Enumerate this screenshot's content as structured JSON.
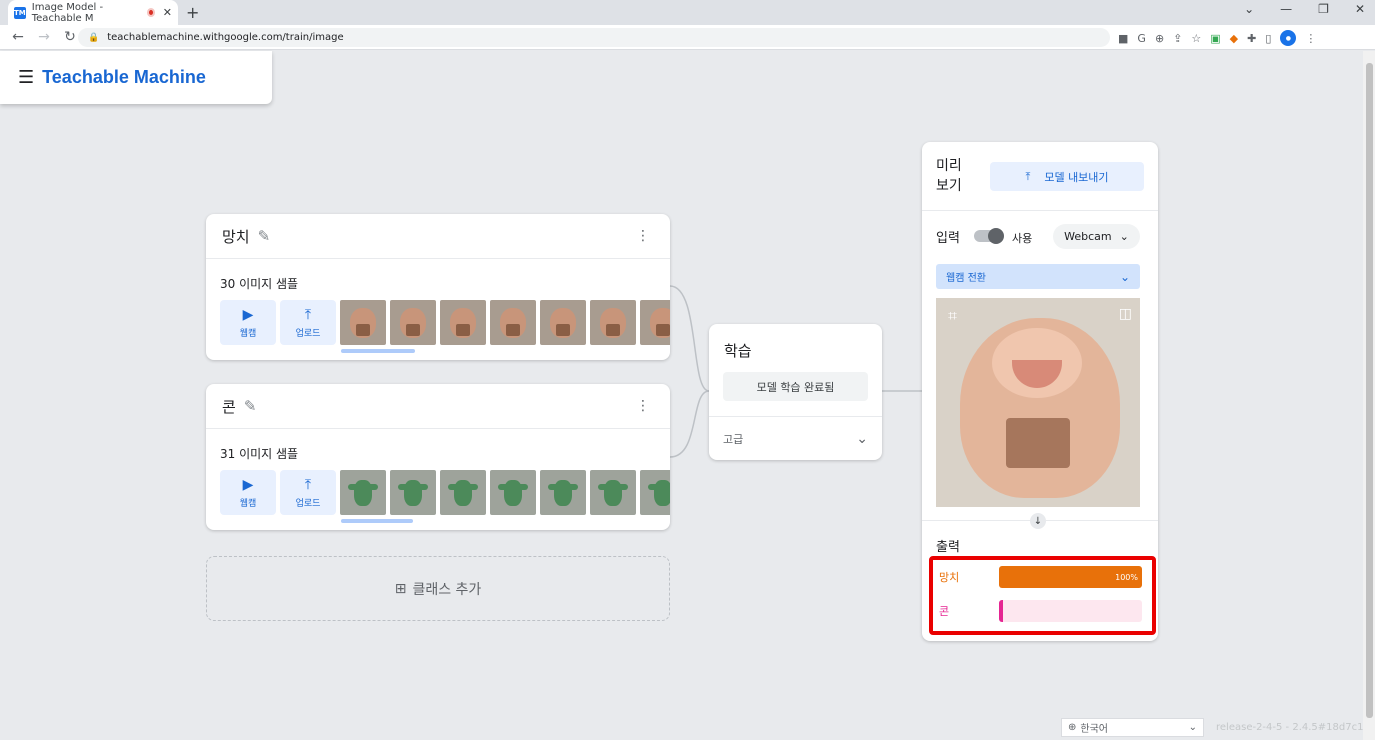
{
  "browser": {
    "tab_title": "Image Model - Teachable M",
    "favicon_text": "TM",
    "url": "teachablemachine.withgoogle.com/train/image"
  },
  "app": {
    "title": "Teachable Machine"
  },
  "classes": [
    {
      "name": "망치",
      "sample_count_label": "30 이미지 샘플",
      "webcam_label": "웹캠",
      "upload_label": "업로드",
      "thumbnail_kind": "bear"
    },
    {
      "name": "콘",
      "sample_count_label": "31 이미지 샘플",
      "webcam_label": "웹캠",
      "upload_label": "업로드",
      "thumbnail_kind": "frog"
    }
  ],
  "add_class_label": "클래스 추가",
  "training": {
    "title": "학습",
    "done_button": "모델 학습 완료됨",
    "advanced_label": "고급"
  },
  "preview": {
    "title": "미리\n보기",
    "export_button": "모델 내보내기",
    "input_label": "입력",
    "toggle_label": "사용",
    "source_select": "Webcam",
    "switch_webcam": "웹캠 전환",
    "output_label": "출력",
    "outputs": [
      {
        "label": "망치",
        "percent": 100,
        "percent_text": "100%",
        "color": "#e8710a",
        "track": "#fce8d6"
      },
      {
        "label": "콘",
        "percent": 0,
        "percent_text": "",
        "color": "#e52592",
        "track": "#fde7ef"
      }
    ]
  },
  "footer": {
    "language": "한국어",
    "release": "release-2-4-5 - 2.4.5#18d7c1"
  },
  "colors": {
    "brand": "#1967d2",
    "highlight_box": "#ea0000"
  }
}
